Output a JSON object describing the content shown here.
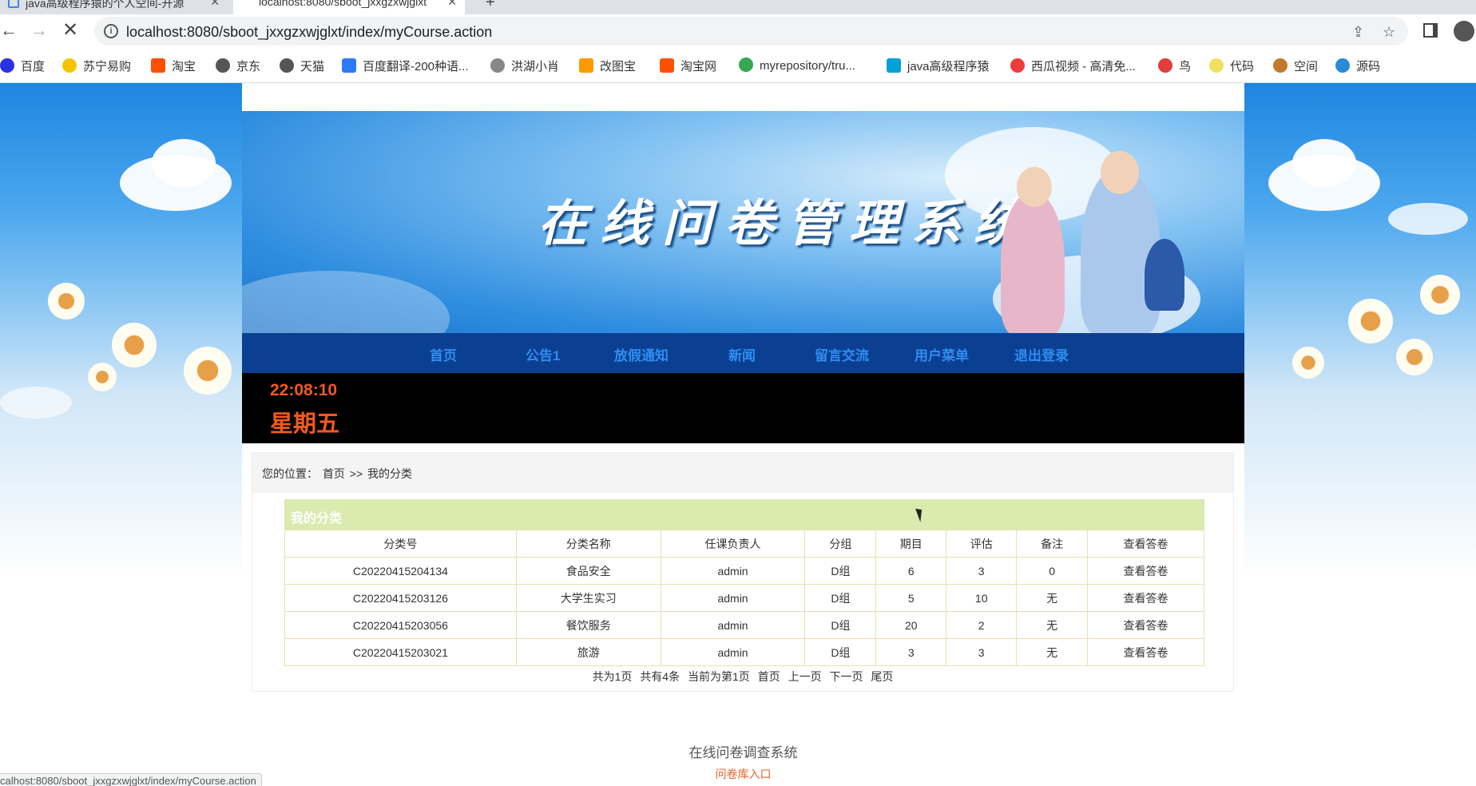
{
  "browser": {
    "tabs": [
      {
        "title": "java高级程序猿的个人空间-开源"
      },
      {
        "title": "localhost:8080/sboot_jxxgzxwjglxt"
      }
    ],
    "url": "localhost:8080/sboot_jxxgzxwjglxt/index/myCourse.action",
    "bookmarks": [
      {
        "label": "百度",
        "icon_color": "#2932e1"
      },
      {
        "label": "苏宁易购",
        "icon_color": "#f5c400"
      },
      {
        "label": "淘宝",
        "icon_color": "#ff5000"
      },
      {
        "label": "京东",
        "icon_color": "#555555"
      },
      {
        "label": "天猫",
        "icon_color": "#555555"
      },
      {
        "label": "百度翻译-200种语...",
        "icon_color": "#2d7af6"
      },
      {
        "label": "洪湖小肖",
        "icon_color": "#888888"
      },
      {
        "label": "改图宝",
        "icon_color": "#ff9900"
      },
      {
        "label": "淘宝网",
        "icon_color": "#ff5000"
      },
      {
        "label": "myrepository/tru...",
        "icon_color": "#34a853"
      },
      {
        "label": "java高级程序猿",
        "icon_color": "#00a1d6"
      },
      {
        "label": "西瓜视频 - 高清免...",
        "icon_color": "#f03c3c"
      },
      {
        "label": "鸟",
        "icon_color": "#e23d3d"
      },
      {
        "label": "代码",
        "icon_color": "#f0e060"
      },
      {
        "label": "空间",
        "icon_color": "#c07a2a"
      },
      {
        "label": "源码",
        "icon_color": "#2a8ad8"
      }
    ],
    "status_url": "calhost:8080/sboot_jxxgzxwjglxt/index/myCourse.action"
  },
  "banner": {
    "title": "在线问卷管理系统"
  },
  "nav": {
    "items": [
      "首页",
      "公告1",
      "放假通知",
      "新闻",
      "留言交流",
      "用户菜单",
      "退出登录"
    ]
  },
  "clock": {
    "time": "22:08:10",
    "weekday": "星期五"
  },
  "breadcrumb": {
    "prefix": "您的位置：",
    "home": "首页",
    "sep": ">>",
    "current": "我的分类"
  },
  "table": {
    "title": "我的分类",
    "headers": [
      "分类号",
      "分类名称",
      "任课负责人",
      "分组",
      "期目",
      "评估",
      "备注",
      "查看答卷"
    ],
    "rows": [
      [
        "C20220415204134",
        "食品安全",
        "admin",
        "D组",
        "6",
        "3",
        "0",
        "查看答卷"
      ],
      [
        "C20220415203126",
        "大学生实习",
        "admin",
        "D组",
        "5",
        "10",
        "无",
        "查看答卷"
      ],
      [
        "C20220415203056",
        "餐饮服务",
        "admin",
        "D组",
        "20",
        "2",
        "无",
        "查看答卷"
      ],
      [
        "C20220415203021",
        "旅游",
        "admin",
        "D组",
        "3",
        "3",
        "无",
        "查看答卷"
      ]
    ]
  },
  "pager": {
    "total_pages": "共为1页",
    "total_items": "共有4条",
    "current": "当前为第1页",
    "first": "首页",
    "prev": "上一页",
    "next": "下一页",
    "last": "尾页"
  },
  "footer": {
    "title": "在线问卷调查系统",
    "link": "问卷库入口"
  }
}
